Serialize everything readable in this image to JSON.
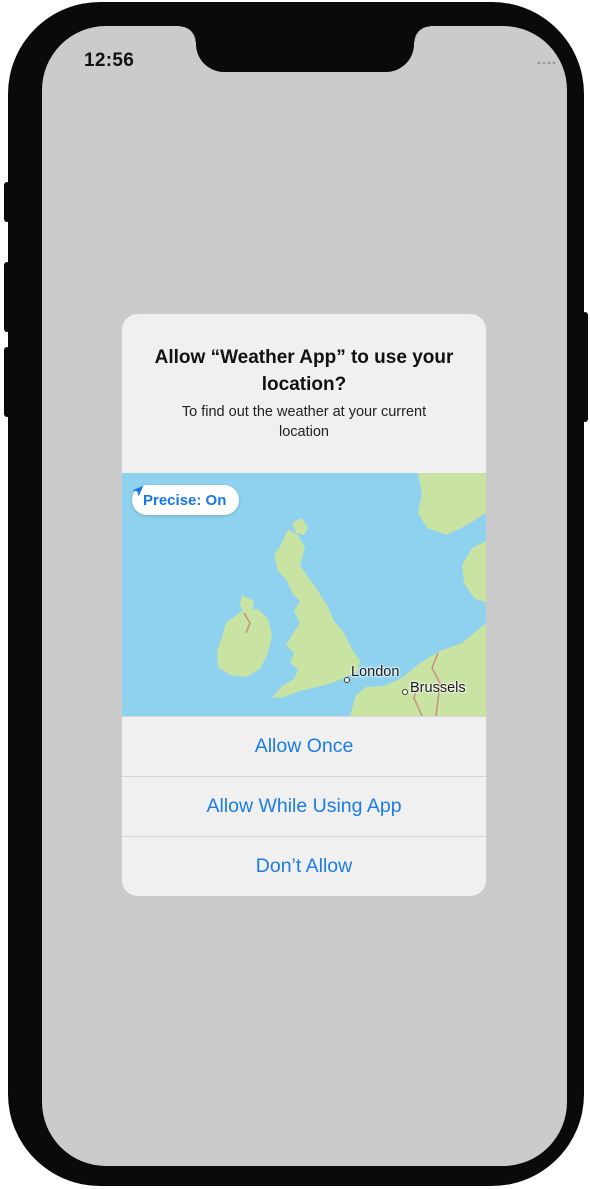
{
  "status_bar": {
    "time": "12:56",
    "icons": [
      "signal-icon",
      "wifi-icon",
      "battery-icon"
    ]
  },
  "alert": {
    "title": "Allow “Weather App” to use your location?",
    "message": "To find out the weather at your current location",
    "map": {
      "precise_label": "Precise: On",
      "cities": [
        "London",
        "Brussels"
      ]
    },
    "buttons": {
      "allow_once": "Allow Once",
      "allow_while_using": "Allow While Using App",
      "dont_allow": "Don’t Allow"
    }
  },
  "colors": {
    "accent": "#1C7CE6",
    "screen_background": "#CBCBCB",
    "alert_background": "#F0F0F0",
    "sea": "#8FD2EF",
    "land": "#C9E3A2"
  }
}
